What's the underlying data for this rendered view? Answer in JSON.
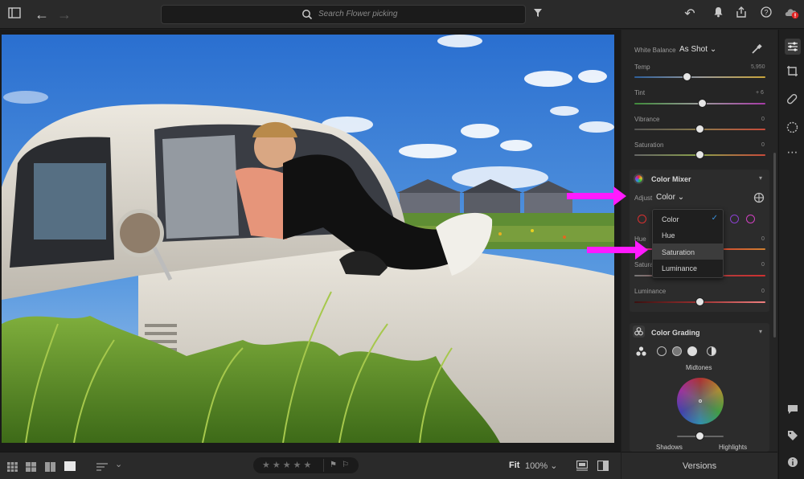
{
  "topbar": {
    "search_placeholder": "Search Flower picking"
  },
  "panel": {
    "white_balance_label": "White Balance",
    "white_balance_value": "As Shot",
    "temp": {
      "label": "Temp",
      "value": "5,950"
    },
    "tint": {
      "label": "Tint",
      "value": "+ 6"
    },
    "vibrance": {
      "label": "Vibrance",
      "value": "0"
    },
    "saturation": {
      "label": "Saturation",
      "value": "0"
    },
    "color_mixer": {
      "title": "Color Mixer",
      "adjust_label": "Adjust",
      "adjust_value": "Color",
      "hue": {
        "label": "Hue",
        "value": "0"
      },
      "saturation": {
        "label": "Saturation",
        "value": "0"
      },
      "luminance": {
        "label": "Luminance",
        "value": "0"
      }
    },
    "dropdown": {
      "options": [
        "Color",
        "Hue",
        "Saturation",
        "Luminance"
      ],
      "checked": "Color",
      "highlighted": "Saturation"
    },
    "color_grading": {
      "title": "Color Grading",
      "midtones_label": "Midtones",
      "shadows_label": "Shadows",
      "highlights_label": "Highlights"
    }
  },
  "bottombar": {
    "fit_label": "Fit",
    "zoom_value": "100%",
    "versions_label": "Versions"
  },
  "colors": {
    "accent": "#ff1aff",
    "check": "#3a8fd8"
  }
}
